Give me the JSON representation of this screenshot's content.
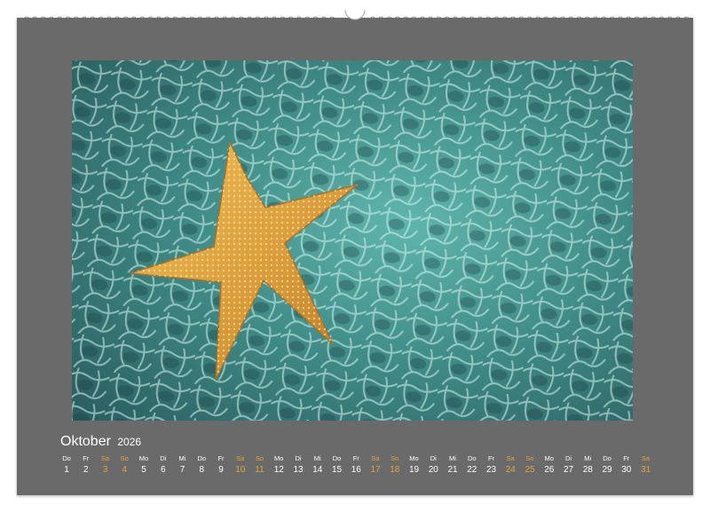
{
  "calendar": {
    "month": "Oktober",
    "year": "2026",
    "days": [
      {
        "wd": "Do",
        "day": "1",
        "weekend": false
      },
      {
        "wd": "Fr",
        "day": "2",
        "weekend": false
      },
      {
        "wd": "Sa",
        "day": "3",
        "weekend": true
      },
      {
        "wd": "So",
        "day": "4",
        "weekend": true
      },
      {
        "wd": "Mo",
        "day": "5",
        "weekend": false
      },
      {
        "wd": "Di",
        "day": "6",
        "weekend": false
      },
      {
        "wd": "Mi",
        "day": "7",
        "weekend": false
      },
      {
        "wd": "Do",
        "day": "8",
        "weekend": false
      },
      {
        "wd": "Fr",
        "day": "9",
        "weekend": false
      },
      {
        "wd": "Sa",
        "day": "10",
        "weekend": true
      },
      {
        "wd": "So",
        "day": "11",
        "weekend": true
      },
      {
        "wd": "Mo",
        "day": "12",
        "weekend": false
      },
      {
        "wd": "Di",
        "day": "13",
        "weekend": false
      },
      {
        "wd": "Mi",
        "day": "14",
        "weekend": false
      },
      {
        "wd": "Do",
        "day": "15",
        "weekend": false
      },
      {
        "wd": "Fr",
        "day": "16",
        "weekend": false
      },
      {
        "wd": "Sa",
        "day": "17",
        "weekend": true
      },
      {
        "wd": "So",
        "day": "18",
        "weekend": true
      },
      {
        "wd": "Mo",
        "day": "19",
        "weekend": false
      },
      {
        "wd": "Di",
        "day": "20",
        "weekend": false
      },
      {
        "wd": "Mi",
        "day": "21",
        "weekend": false
      },
      {
        "wd": "Do",
        "day": "22",
        "weekend": false
      },
      {
        "wd": "Fr",
        "day": "23",
        "weekend": false
      },
      {
        "wd": "Sa",
        "day": "24",
        "weekend": true
      },
      {
        "wd": "So",
        "day": "25",
        "weekend": true
      },
      {
        "wd": "Mo",
        "day": "26",
        "weekend": false
      },
      {
        "wd": "Di",
        "day": "27",
        "weekend": false
      },
      {
        "wd": "Mi",
        "day": "28",
        "weekend": false
      },
      {
        "wd": "Do",
        "day": "29",
        "weekend": false
      },
      {
        "wd": "Fr",
        "day": "30",
        "weekend": false
      },
      {
        "wd": "Sa",
        "day": "31",
        "weekend": true
      }
    ]
  },
  "photo": {
    "subject": "starfish-icon"
  },
  "colors": {
    "sheet": "#6a6a6a",
    "weekend": "#e3a640",
    "text": "#ffffff",
    "water": "#3f8a86",
    "starfish": "#d9a040"
  }
}
